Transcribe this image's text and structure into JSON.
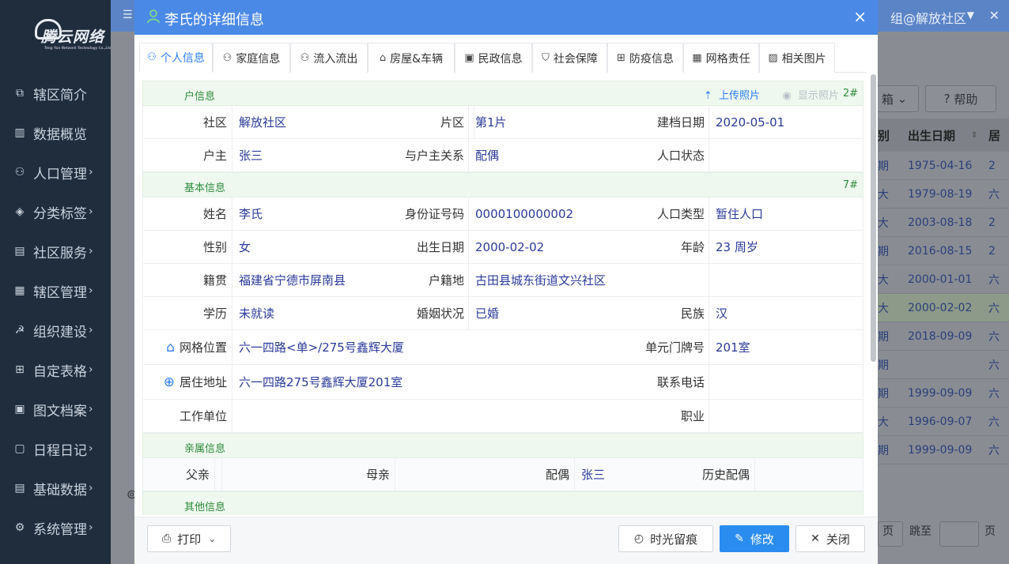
{
  "background": {
    "logo_text": "腾云网络",
    "logo_sub": "Teng Yun Network Technology Co.,Ltd",
    "topbar_user": "组@解放社区",
    "nav": [
      {
        "label": "辖区简介",
        "icon": "home-icon",
        "arrow": ""
      },
      {
        "label": "数据概览",
        "icon": "chart-icon",
        "arrow": ""
      },
      {
        "label": "人口管理",
        "icon": "person-icon",
        "arrow": "›"
      },
      {
        "label": "分类标签",
        "icon": "tag-icon",
        "arrow": "›"
      },
      {
        "label": "社区服务",
        "icon": "document-icon",
        "arrow": "›"
      },
      {
        "label": "辖区管理",
        "icon": "building-icon",
        "arrow": "›"
      },
      {
        "label": "组织建设",
        "icon": "party-icon",
        "arrow": "›"
      },
      {
        "label": "自定表格",
        "icon": "grid-icon",
        "arrow": "›"
      },
      {
        "label": "图文档案",
        "icon": "archive-icon",
        "arrow": "›"
      },
      {
        "label": "日程日记",
        "icon": "calendar-icon",
        "arrow": "›"
      },
      {
        "label": "基础数据",
        "icon": "database-icon",
        "arrow": "›"
      },
      {
        "label": "系统管理",
        "icon": "gear-icon",
        "arrow": "›"
      }
    ],
    "toolbar": {
      "box_label": "箱",
      "help_label": "帮助"
    },
    "table_headers": {
      "col_a": "别",
      "col_b": "出生日期",
      "col_c": "居"
    },
    "rows": [
      {
        "a": "期",
        "date": "1975-04-16",
        "b": "2"
      },
      {
        "a": "大",
        "date": "1979-08-19",
        "b": "六"
      },
      {
        "a": "大",
        "date": "2003-08-18",
        "b": "2"
      },
      {
        "a": "期",
        "date": "2016-08-15",
        "b": "2"
      },
      {
        "a": "大",
        "date": "2000-01-01",
        "b": "六"
      },
      {
        "a": "大",
        "date": "2000-02-02",
        "b": "六"
      },
      {
        "a": "期",
        "date": "2018-09-09",
        "b": "六"
      },
      {
        "a": "期",
        "date": "",
        "b": "六"
      },
      {
        "a": "期",
        "date": "1999-09-09",
        "b": "六"
      },
      {
        "a": "大",
        "date": "1996-09-07",
        "b": "六"
      },
      {
        "a": "期",
        "date": "1999-09-09",
        "b": "六"
      }
    ],
    "pager": {
      "page_suffix": "页",
      "jump_label": "跳至",
      "page_unit": "页"
    }
  },
  "modal": {
    "title": "李氏的详细信息",
    "close_glyph": "×",
    "tabs": [
      {
        "label": "个人信息",
        "icon": "person-icon",
        "glyph": "ⓐ"
      },
      {
        "label": "家庭信息",
        "icon": "family-icon",
        "glyph": "ⓐ"
      },
      {
        "label": "流入流出",
        "icon": "migration-icon",
        "glyph": "ⓐ"
      },
      {
        "label": "房屋&车辆",
        "icon": "house-icon",
        "glyph": "⌂"
      },
      {
        "label": "民政信息",
        "icon": "civil-icon",
        "glyph": "▣"
      },
      {
        "label": "社会保障",
        "icon": "shield-icon",
        "glyph": "⛉"
      },
      {
        "label": "防疫信息",
        "icon": "medical-icon",
        "glyph": "⊕"
      },
      {
        "label": "网格责任",
        "icon": "grid-duty-icon",
        "glyph": "▦"
      },
      {
        "label": "相关图片",
        "icon": "image-icon",
        "glyph": "▨"
      }
    ],
    "household_section": {
      "title": "户信息",
      "count": "2#",
      "upload": "上传照片",
      "show": "显示照片"
    },
    "household": {
      "community_label": "社区",
      "community": "解放社区",
      "area_label": "片区",
      "area": "第1片",
      "filed_label": "建档日期",
      "filed": "2020-05-01",
      "head_label": "户主",
      "head": "张三",
      "relation_label": "与户主关系",
      "relation": "配偶",
      "status_label": "人口状态",
      "status": ""
    },
    "basic_section": {
      "title": "基本信息",
      "count": "7#"
    },
    "basic": {
      "name_label": "姓名",
      "name": "李氏",
      "id_label": "身份证号码",
      "id": "0000100000002",
      "ptype_label": "人口类型",
      "ptype": "暂住人口",
      "gender_label": "性别",
      "gender": "女",
      "birth_label": "出生日期",
      "birth": "2000-02-02",
      "age_label": "年龄",
      "age": "23 周岁",
      "native_label": "籍贯",
      "native": "福建省宁德市屏南县",
      "hukou_label": "户籍地",
      "hukou": "古田县城东街道文兴社区",
      "edu_label": "学历",
      "edu": "未就读",
      "marital_label": "婚姻状况",
      "marital": "已婚",
      "ethnic_label": "民族",
      "ethnic": "汉",
      "grid_label": "网格位置",
      "grid": "六一四路<单>/275号鑫辉大厦",
      "unit_label": "单元门牌号",
      "unit": "201室",
      "addr_label": "居住地址",
      "addr": "六一四路275号鑫辉大厦201室",
      "phone_label": "联系电话",
      "phone": "",
      "work_label": "工作单位",
      "work": "",
      "job_label": "职业",
      "job": ""
    },
    "relatives_section": {
      "title": "亲属信息"
    },
    "relatives": {
      "father_label": "父亲",
      "father": "",
      "mother_label": "母亲",
      "mother": "",
      "spouse_label": "配偶",
      "spouse": "张三",
      "hist_label": "历史配偶",
      "hist": ""
    },
    "other_section": {
      "title": "其他信息"
    },
    "footer": {
      "print": "打印",
      "history": "时光留痕",
      "edit": "修改",
      "close": "关闭"
    }
  }
}
